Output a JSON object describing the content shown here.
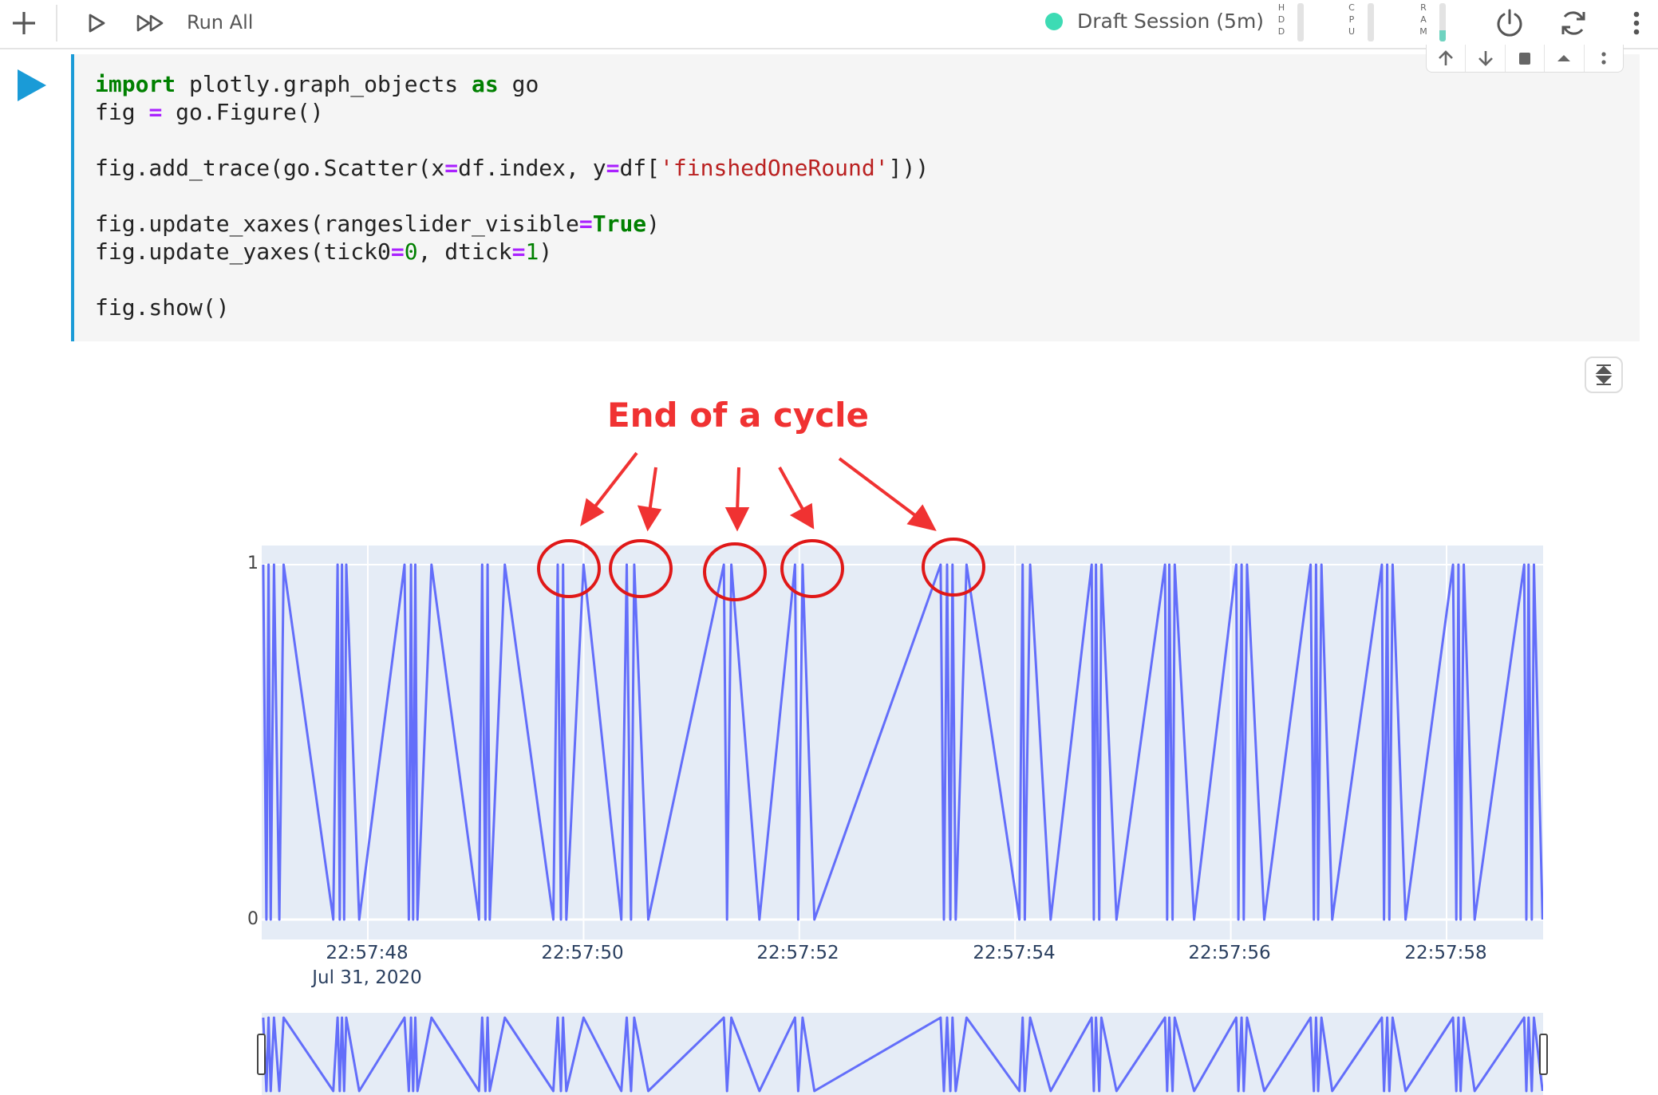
{
  "toolbar": {
    "add_icon": "plus-icon",
    "run_icon": "play-outline-icon",
    "run_all_icon": "fast-forward-icon",
    "run_all_label": "Run All",
    "session_label": "Draft Session (5m)",
    "session_color": "#3ddbb4",
    "meters": [
      {
        "letters": [
          "H",
          "D",
          "D"
        ],
        "level": 0.0
      },
      {
        "letters": [
          "C",
          "P",
          "U"
        ],
        "level": 0.0
      },
      {
        "letters": [
          "R",
          "A",
          "M"
        ],
        "level": 0.3
      }
    ],
    "power_icon": "power-icon",
    "refresh_icon": "refresh-icon",
    "more_icon": "vertical-ellipsis-icon"
  },
  "cell": {
    "run_icon": "play-icon",
    "accent_color": "#1a9bd7",
    "code_lines": [
      "import plotly.graph_objects as go",
      "fig = go.Figure()",
      "",
      "fig.add_trace(go.Scatter(x=df.index, y=df['finshedOneRound']))",
      "",
      "fig.update_xaxes(rangeslider_visible=True)",
      "fig.update_yaxes(tick0=0, dtick=1)",
      "",
      "fig.show()"
    ],
    "tools": [
      "move-up-icon",
      "move-down-icon",
      "delete-icon",
      "collapse-up-icon",
      "more-icon"
    ]
  },
  "output": {
    "collapse_icon": "collapse-vertical-icon"
  },
  "annotation": {
    "text": "End of a cycle",
    "color": "#f03232"
  },
  "chart_data": {
    "type": "line",
    "line_color": "#636efa",
    "plot_bg": "#e5ecf6",
    "x_label_sub": "Jul 31, 2020",
    "x_ticks": [
      "22:57:48",
      "22:57:50",
      "22:57:52",
      "22:57:54",
      "22:57:56",
      "22:57:58"
    ],
    "y_ticks": [
      "0",
      "1"
    ],
    "xlim_seconds": [
      47.0,
      58.9
    ],
    "ylim": [
      0,
      1
    ],
    "rangeslider": true,
    "x_seconds": [
      47.03,
      47.06,
      47.08,
      47.1,
      47.13,
      47.18,
      47.22,
      47.68,
      47.72,
      47.74,
      47.76,
      47.78,
      47.8,
      47.92,
      48.34,
      48.38,
      48.4,
      48.42,
      48.44,
      48.46,
      48.59,
      49.03,
      49.06,
      49.09,
      49.11,
      49.13,
      49.27,
      49.72,
      49.76,
      49.79,
      49.81,
      49.84,
      50.0,
      50.35,
      50.4,
      50.44,
      50.47,
      50.6,
      51.3,
      51.33,
      51.37,
      51.63,
      51.96,
      51.99,
      52.03,
      52.14,
      53.31,
      53.34,
      53.37,
      53.4,
      53.42,
      53.45,
      53.55,
      54.04,
      54.07,
      54.09,
      54.14,
      54.33,
      54.71,
      54.73,
      54.75,
      54.78,
      54.8,
      54.94,
      55.39,
      55.41,
      55.43,
      55.46,
      55.48,
      55.66,
      56.05,
      56.07,
      56.1,
      56.12,
      56.15,
      56.31,
      56.74,
      56.77,
      56.79,
      56.81,
      56.84,
      56.94,
      57.4,
      57.42,
      57.45,
      57.47,
      57.5,
      57.62,
      58.06,
      58.09,
      58.11,
      58.13,
      58.16,
      58.26,
      58.72,
      58.74,
      58.76,
      58.79,
      58.81,
      58.89
    ],
    "y_values": [
      1,
      0,
      1,
      0,
      1,
      0,
      1,
      0,
      1,
      0,
      1,
      0,
      1,
      0,
      1,
      0,
      1,
      0,
      1,
      0,
      1,
      0,
      1,
      0,
      1,
      0,
      1,
      0,
      1,
      0,
      1,
      0,
      1,
      0,
      1,
      0,
      1,
      0,
      1,
      0,
      1,
      0,
      1,
      0,
      1,
      0,
      1,
      0,
      1,
      0,
      1,
      0,
      1,
      0,
      1,
      0,
      1,
      0,
      1,
      0,
      1,
      0,
      1,
      0,
      1,
      0,
      1,
      0,
      1,
      0,
      1,
      0,
      1,
      0,
      1,
      0,
      1,
      0,
      1,
      0,
      1,
      0,
      1,
      0,
      1,
      0,
      1,
      0,
      1,
      0,
      1,
      0,
      1,
      0,
      1,
      0,
      1,
      0,
      1,
      0,
      1,
      0
    ]
  }
}
